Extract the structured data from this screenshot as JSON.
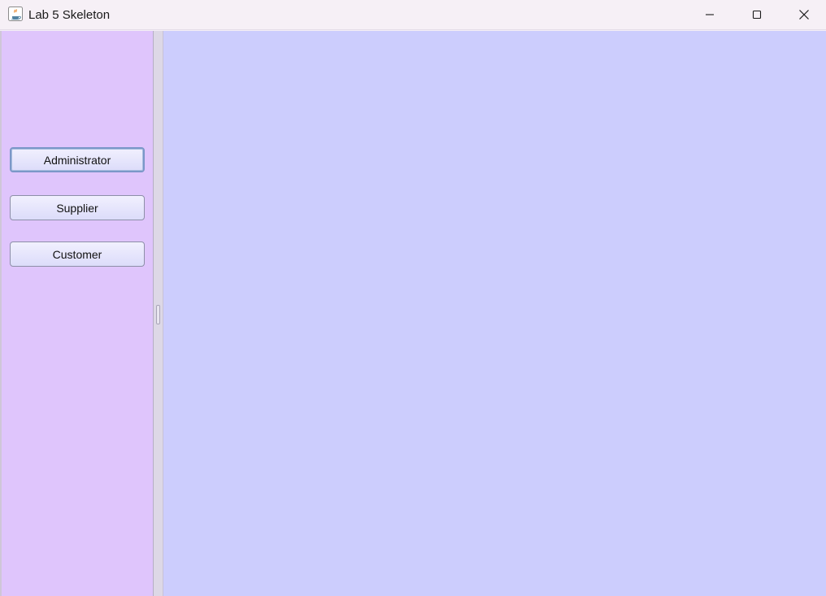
{
  "window": {
    "title": "Lab 5 Skeleton",
    "controls": {
      "minimize": "minimize-icon",
      "maximize": "maximize-icon",
      "close": "close-icon"
    }
  },
  "sidebar": {
    "buttons": [
      {
        "label": "Administrator",
        "focused": true
      },
      {
        "label": "Supplier",
        "focused": false
      },
      {
        "label": "Customer",
        "focused": false
      }
    ]
  },
  "colors": {
    "sidebar_bg": "#dfc5fc",
    "main_bg": "#cccdfd",
    "button_bg": "#e4e3fb",
    "focus_border": "#7b97c8"
  }
}
